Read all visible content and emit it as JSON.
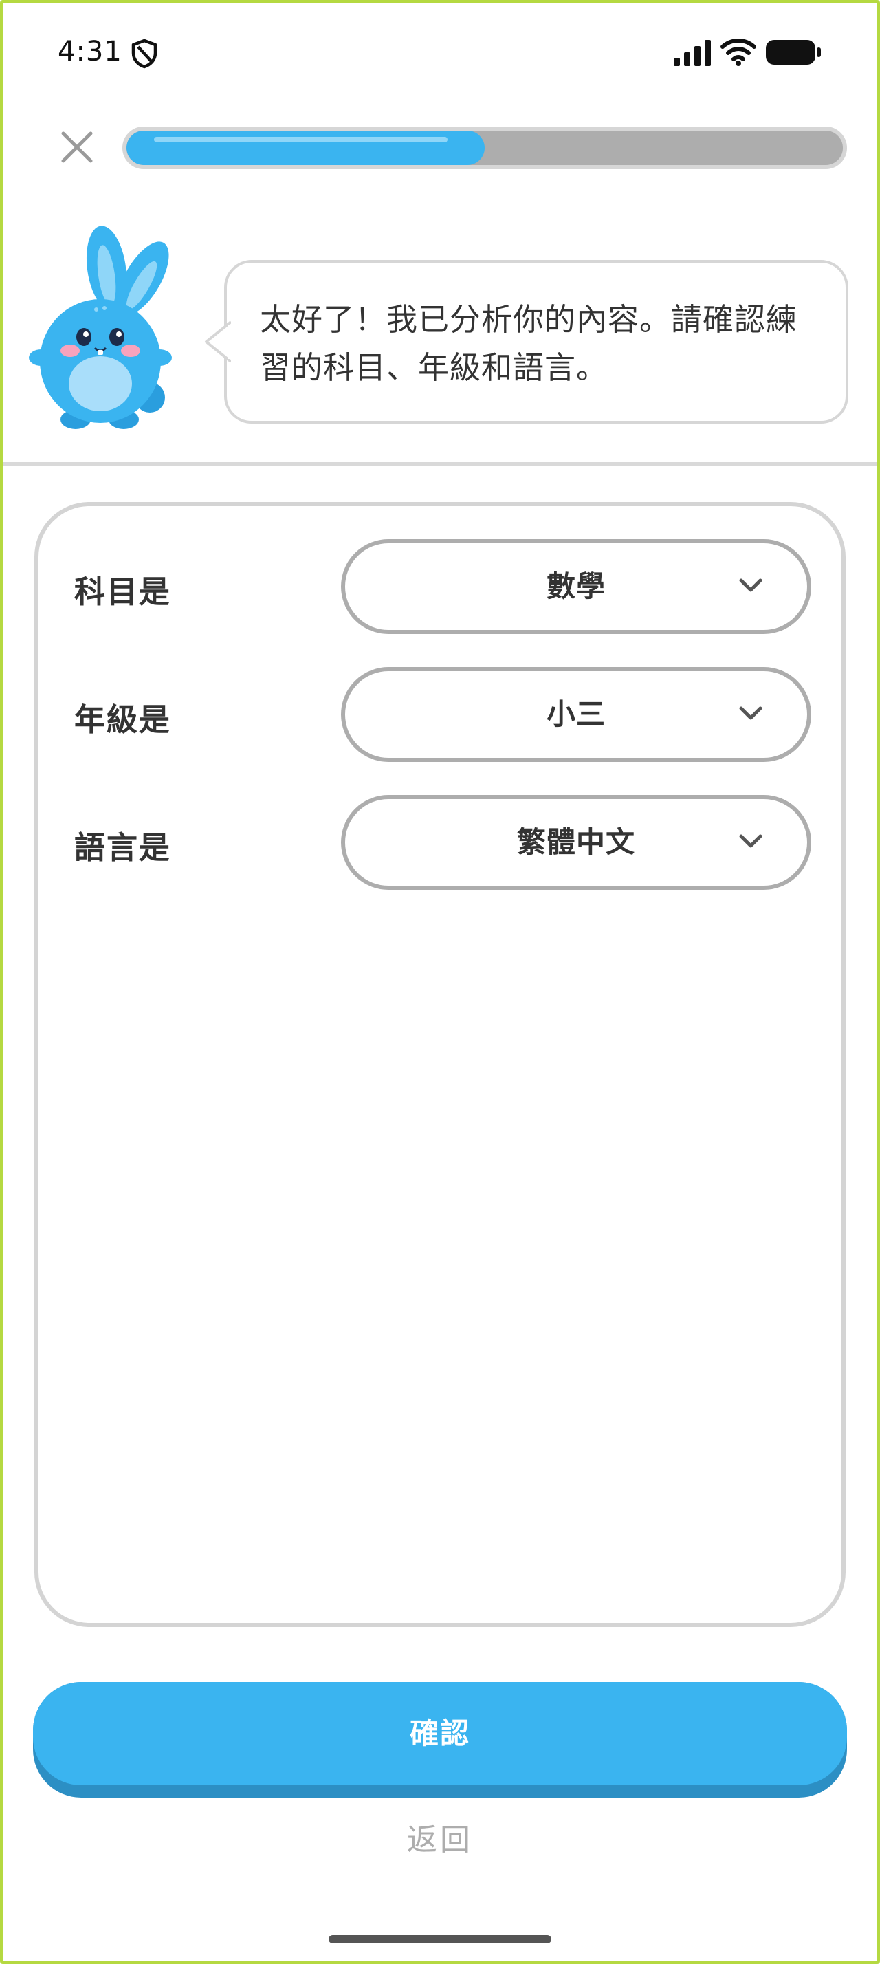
{
  "status_bar": {
    "time": "4:31",
    "icons": [
      "shield-icon",
      "signal-icon",
      "wifi-icon",
      "battery-icon"
    ]
  },
  "header": {
    "close_icon": "close-icon",
    "progress_fraction": 0.5
  },
  "mascot": {
    "icon": "bunny-mascot",
    "message": "太好了！我已分析你的內容。請確認練習的科目、年級和語言。"
  },
  "settings": [
    {
      "label": "科目是",
      "value": "數學"
    },
    {
      "label": "年級是",
      "value": "小三"
    },
    {
      "label": "語言是",
      "value": "繁體中文"
    }
  ],
  "footer": {
    "confirm_label": "確認",
    "back_label": "返回"
  },
  "colors": {
    "accent": "#3ab4f0",
    "accent_shadow": "#2c8fc4",
    "muted": "#adadad",
    "frame": "#b5d941"
  }
}
